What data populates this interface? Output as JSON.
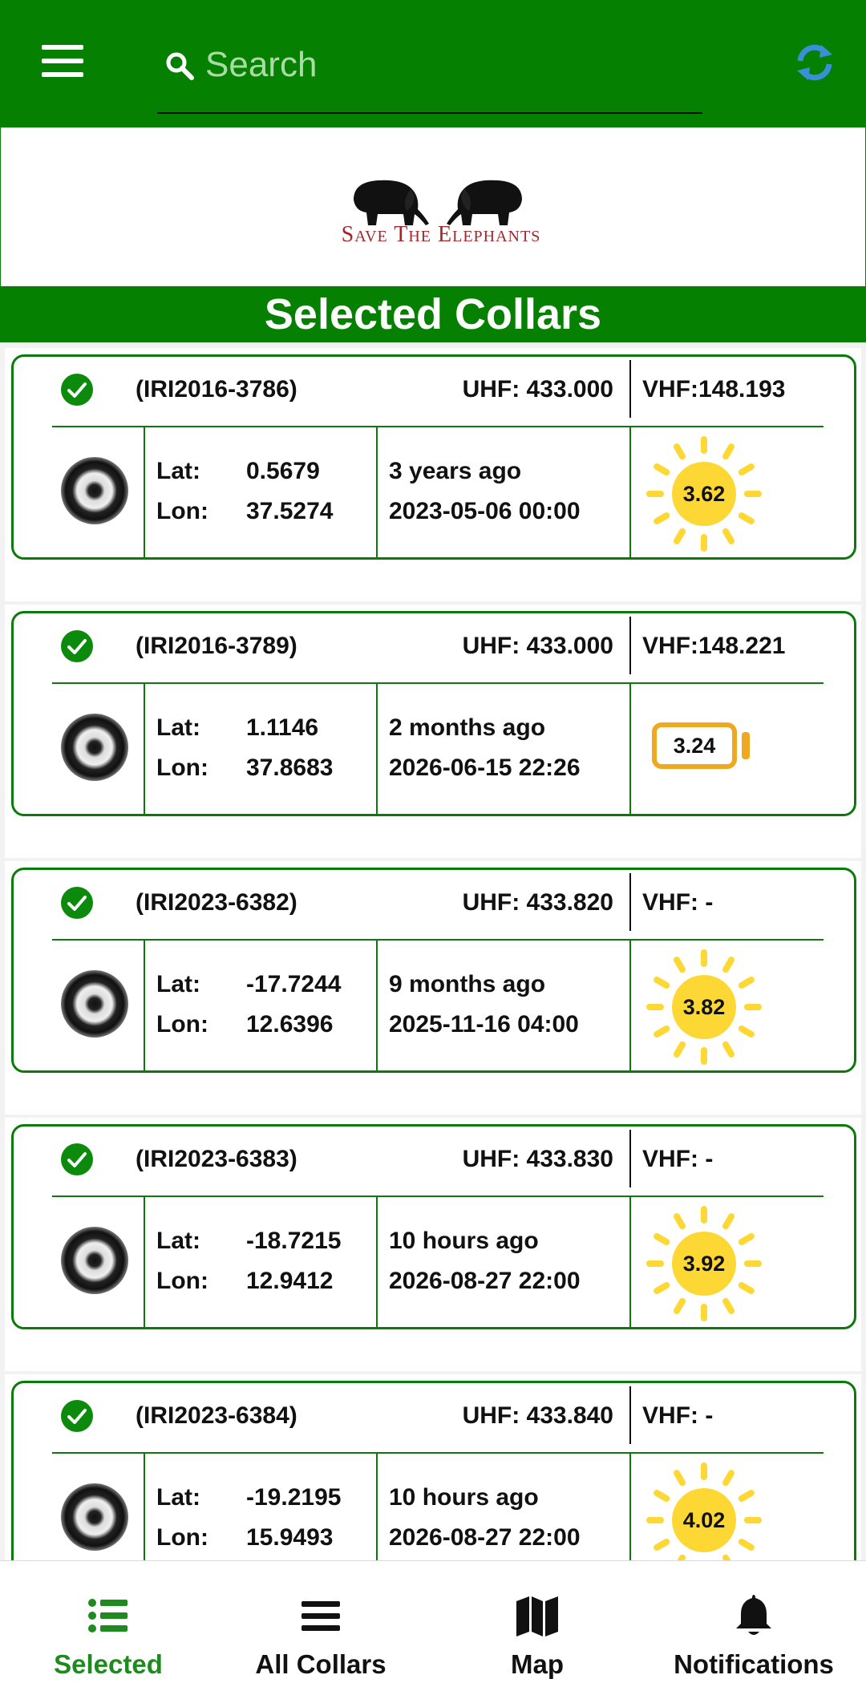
{
  "search": {
    "placeholder": "Search"
  },
  "logo": {
    "text": "Save The Elephants"
  },
  "section_title": "Selected Collars",
  "labels": {
    "lat": "Lat:",
    "lon": "Lon:"
  },
  "colors": {
    "primary": "#058000",
    "sun": "#FDD835",
    "battery": "#F0A820"
  },
  "collars": [
    {
      "id": "(IRI2016-3786)",
      "uhf": "UHF: 433.000",
      "vhf": "VHF:148.193",
      "lat": "0.5679",
      "lon": "37.5274",
      "ago": "3 years ago",
      "datetime": "2023-05-06 00:00",
      "power_icon": "sun-icon",
      "power_value": "3.62"
    },
    {
      "id": "(IRI2016-3789)",
      "uhf": "UHF: 433.000",
      "vhf": "VHF:148.221",
      "lat": "1.1146",
      "lon": "37.8683",
      "ago": "2 months ago",
      "datetime": "2026-06-15 22:26",
      "power_icon": "battery-icon",
      "power_value": "3.24"
    },
    {
      "id": "(IRI2023-6382)",
      "uhf": "UHF: 433.820",
      "vhf": "VHF: -",
      "lat": "-17.7244",
      "lon": "12.6396",
      "ago": "9 months ago",
      "datetime": "2025-11-16 04:00",
      "power_icon": "sun-icon",
      "power_value": "3.82"
    },
    {
      "id": "(IRI2023-6383)",
      "uhf": "UHF: 433.830",
      "vhf": "VHF: -",
      "lat": "-18.7215",
      "lon": "12.9412",
      "ago": "10 hours ago",
      "datetime": "2026-08-27 22:00",
      "power_icon": "sun-icon",
      "power_value": "3.92"
    },
    {
      "id": "(IRI2023-6384)",
      "uhf": "UHF: 433.840",
      "vhf": "VHF: -",
      "lat": "-19.2195",
      "lon": "15.9493",
      "ago": "10 hours ago",
      "datetime": "2026-08-27 22:00",
      "power_icon": "sun-icon",
      "power_value": "4.02"
    }
  ],
  "nav": [
    {
      "label": "Selected",
      "icon": "list-icon",
      "active": true
    },
    {
      "label": "All Collars",
      "icon": "menu-lines-icon",
      "active": false
    },
    {
      "label": "Map",
      "icon": "map-icon",
      "active": false
    },
    {
      "label": "Notifications",
      "icon": "bell-icon",
      "active": false
    }
  ]
}
